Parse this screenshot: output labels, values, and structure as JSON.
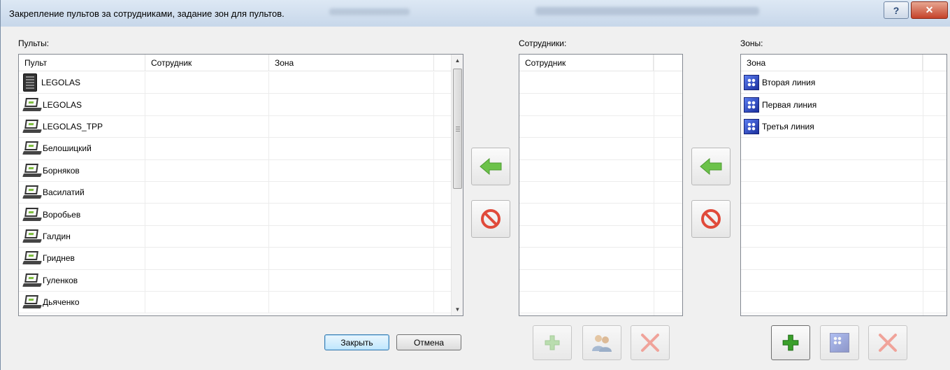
{
  "window": {
    "title": "Закрепление пультов за сотрудниками, задание зон для пультов.",
    "help_glyph": "?",
    "close_glyph": "✕"
  },
  "consoles_panel": {
    "label": "Пульты:",
    "columns": [
      "Пульт",
      "Сотрудник",
      "Зона"
    ],
    "rows": [
      {
        "name": "LEGOLAS",
        "icon": "pda-icon",
        "employee": "",
        "zone": ""
      },
      {
        "name": "LEGOLAS",
        "icon": "laptop-icon",
        "employee": "",
        "zone": ""
      },
      {
        "name": "LEGOLAS_TPP",
        "icon": "laptop-icon",
        "employee": "",
        "zone": ""
      },
      {
        "name": "Белошицкий",
        "icon": "laptop-icon",
        "employee": "",
        "zone": ""
      },
      {
        "name": "Борняков",
        "icon": "laptop-icon",
        "employee": "",
        "zone": ""
      },
      {
        "name": "Василатий",
        "icon": "laptop-icon",
        "employee": "",
        "zone": ""
      },
      {
        "name": "Воробьев",
        "icon": "laptop-icon",
        "employee": "",
        "zone": ""
      },
      {
        "name": "Галдин",
        "icon": "laptop-icon",
        "employee": "",
        "zone": ""
      },
      {
        "name": "Гриднев",
        "icon": "laptop-icon",
        "employee": "",
        "zone": ""
      },
      {
        "name": "Гуленков",
        "icon": "laptop-icon",
        "employee": "",
        "zone": ""
      },
      {
        "name": "Дьяченко",
        "icon": "laptop-icon",
        "employee": "",
        "zone": ""
      }
    ]
  },
  "employees_panel": {
    "label": "Сотрудники:",
    "columns": [
      "Сотрудник"
    ],
    "rows": []
  },
  "zones_panel": {
    "label": "Зоны:",
    "columns": [
      "Зона"
    ],
    "rows": [
      {
        "name": "Вторая линия",
        "icon": "zone-icon"
      },
      {
        "name": "Первая линия",
        "icon": "zone-icon"
      },
      {
        "name": "Третья линия",
        "icon": "zone-icon"
      }
    ]
  },
  "buttons": {
    "close_label": "Закрыть",
    "cancel_label": "Отмена"
  },
  "colors": {
    "arrow_green": "#6cc24a",
    "remove_red": "#e04a3a",
    "add_green": "#3aa02a"
  }
}
